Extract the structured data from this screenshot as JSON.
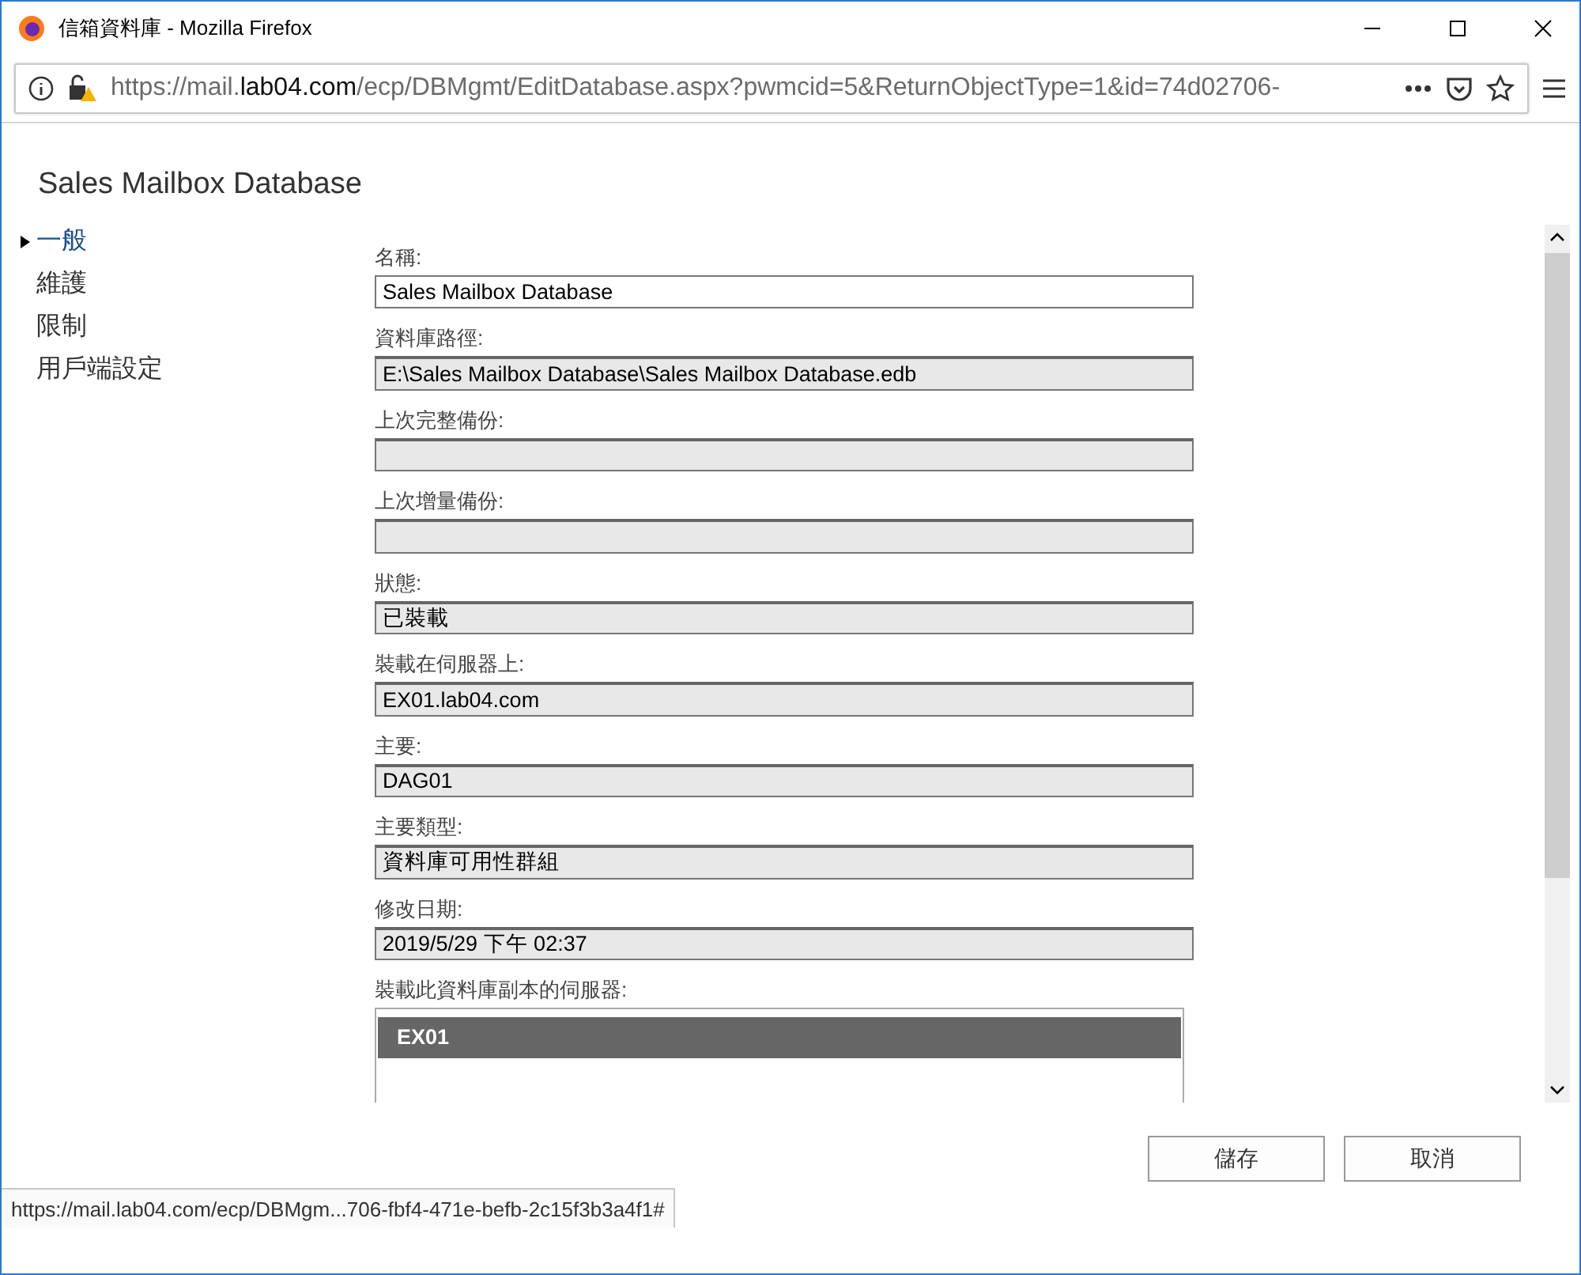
{
  "window": {
    "title": "信箱資料庫 - Mozilla Firefox"
  },
  "address_bar": {
    "url_prefix": "https://mail.",
    "url_domain": "lab04.com",
    "url_path": "/ecp/DBMgmt/EditDatabase.aspx?pwmcid=5&ReturnObjectType=1&id=74d02706-"
  },
  "page_title": "Sales Mailbox Database",
  "nav": [
    {
      "label": "一般",
      "selected": true
    },
    {
      "label": "維護",
      "selected": false
    },
    {
      "label": "限制",
      "selected": false
    },
    {
      "label": "用戶端設定",
      "selected": false
    }
  ],
  "fields": [
    {
      "label": "名稱:",
      "value": "Sales Mailbox Database",
      "disabled": false
    },
    {
      "label": "資料庫路徑:",
      "value": "E:\\Sales Mailbox Database\\Sales Mailbox Database.edb",
      "disabled": true
    },
    {
      "label": "上次完整備份:",
      "disabled": true
    },
    {
      "label": "上次增量備份:",
      "disabled": true
    },
    {
      "label": "狀態:",
      "value": "已裝載",
      "disabled": true
    },
    {
      "label": "裝載在伺服器上:",
      "value": "EX01.lab04.com",
      "disabled": true
    },
    {
      "label": "主要:",
      "value": "DAG01",
      "disabled": true
    },
    {
      "label": "主要類型:",
      "value": "資料庫可用性群組",
      "disabled": true
    },
    {
      "label": "修改日期:",
      "value": "2019/5/29 下午 02:37",
      "disabled": true
    }
  ],
  "servers": {
    "label": "裝載此資料庫副本的伺服器:",
    "items": [
      {
        "name": "EX01",
        "selected": true
      }
    ]
  },
  "buttons": [
    "儲存",
    "取消"
  ],
  "status_bar": {
    "url": "https://mail.lab04.com/ecp/DBMgm...706-fbf4-471e-befb-2c15f3b3a4f1#"
  }
}
